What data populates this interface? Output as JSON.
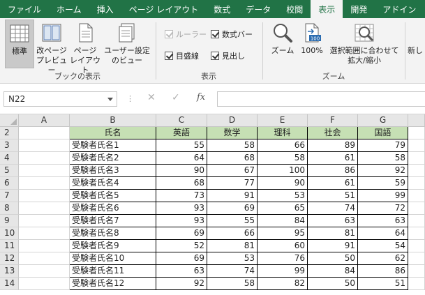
{
  "ribbon_tabs": [
    "ファイル",
    "ホーム",
    "挿入",
    "ページ レイアウト",
    "数式",
    "データ",
    "校閲",
    "表示",
    "開発",
    "アドイン"
  ],
  "active_tab": "表示",
  "groups": {
    "workbook_views": {
      "label": "ブックの表示",
      "buttons": [
        {
          "line1": "標準",
          "line2": ""
        },
        {
          "line1": "改ページ",
          "line2": "プレビュー"
        },
        {
          "line1": "ページ",
          "line2": "レイアウト"
        },
        {
          "line1": "ユーザー設定",
          "line2": "のビュー"
        }
      ]
    },
    "show": {
      "label": "表示",
      "ruler": "ルーラー",
      "formula_bar": "数式バー",
      "gridlines": "目盛線",
      "headings": "見出し"
    },
    "zoom": {
      "label": "ズーム",
      "zoom": "ズーム",
      "hundred": "100%",
      "hundred_icon_text": "100",
      "selection_line1": "選択範囲に合わせて",
      "selection_line2": "拡大/縮小"
    },
    "window": {
      "new_partial": "新し"
    }
  },
  "formula_bar": {
    "name_box": "N22",
    "fx": "fx"
  },
  "colors": {
    "ribbon_green": "#217346",
    "header_fill": "#c6e0b4"
  },
  "sheet": {
    "columns": [
      "A",
      "B",
      "C",
      "D",
      "E",
      "F",
      "G"
    ],
    "header_row": {
      "row": "2",
      "cells": [
        "氏名",
        "英語",
        "数学",
        "理科",
        "社会",
        "国語"
      ]
    },
    "rows": [
      {
        "row": "3",
        "name": "受験者氏名1",
        "values": [
          "55",
          "58",
          "66",
          "89",
          "79"
        ]
      },
      {
        "row": "4",
        "name": "受験者氏名2",
        "values": [
          "64",
          "68",
          "58",
          "61",
          "58"
        ]
      },
      {
        "row": "5",
        "name": "受験者氏名3",
        "values": [
          "90",
          "67",
          "100",
          "86",
          "92"
        ]
      },
      {
        "row": "6",
        "name": "受験者氏名4",
        "values": [
          "68",
          "77",
          "90",
          "61",
          "59"
        ]
      },
      {
        "row": "7",
        "name": "受験者氏名5",
        "values": [
          "73",
          "91",
          "53",
          "51",
          "99"
        ]
      },
      {
        "row": "8",
        "name": "受験者氏名6",
        "values": [
          "93",
          "69",
          "65",
          "74",
          "72"
        ]
      },
      {
        "row": "9",
        "name": "受験者氏名7",
        "values": [
          "93",
          "55",
          "84",
          "63",
          "63"
        ]
      },
      {
        "row": "10",
        "name": "受験者氏名8",
        "values": [
          "69",
          "66",
          "95",
          "81",
          "64"
        ]
      },
      {
        "row": "11",
        "name": "受験者氏名9",
        "values": [
          "52",
          "81",
          "60",
          "91",
          "54"
        ]
      },
      {
        "row": "12",
        "name": "受験者氏名10",
        "values": [
          "69",
          "53",
          "76",
          "50",
          "62"
        ]
      },
      {
        "row": "13",
        "name": "受験者氏名11",
        "values": [
          "63",
          "74",
          "99",
          "84",
          "86"
        ]
      },
      {
        "row": "14",
        "name": "受験者氏名12",
        "values": [
          "92",
          "58",
          "82",
          "50",
          "51"
        ]
      }
    ]
  }
}
